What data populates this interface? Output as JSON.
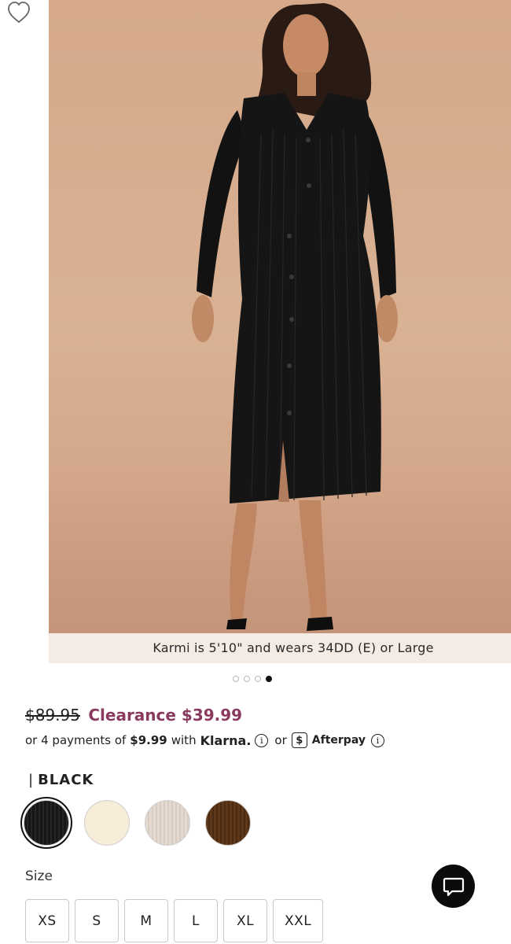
{
  "product_image": {
    "caption": "Karmi is 5'10\" and wears 34DD (E) or Large",
    "carousel_total": 4,
    "carousel_active_index": 4
  },
  "wishlist": {
    "icon": "heart-outline-icon"
  },
  "pricing": {
    "original_price": "$89.95",
    "sale_price": "Clearance $39.99",
    "sale_color": "#8a3a5f"
  },
  "installments": {
    "prefix": "or 4 payments of",
    "amount": "$9.99",
    "with": "with",
    "klarna": "Klarna.",
    "or": "or",
    "afterpay_icon_glyph": "$",
    "afterpay": "Afterpay"
  },
  "color": {
    "pipe": "|",
    "selected_name": "BLACK",
    "swatches": [
      {
        "name": "black",
        "hex": "#1a1a1a",
        "selected": true
      },
      {
        "name": "cream",
        "hex": "#f6ecd8",
        "selected": false
      },
      {
        "name": "oatmeal",
        "hex": "#e1d6cc",
        "selected": false
      },
      {
        "name": "brown",
        "hex": "#5a3516",
        "selected": false
      }
    ]
  },
  "size": {
    "label": "Size",
    "options": [
      "XS",
      "S",
      "M",
      "L",
      "XL",
      "XXL"
    ]
  },
  "chat": {
    "icon": "chat-bubble-icon"
  }
}
